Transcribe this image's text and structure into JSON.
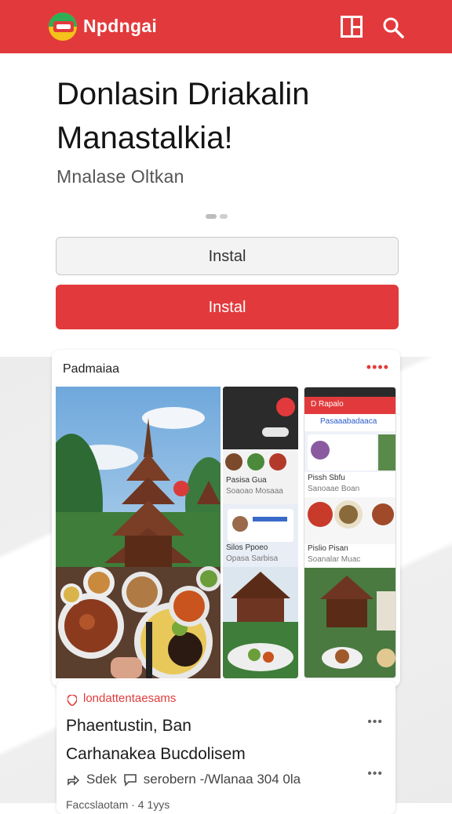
{
  "header": {
    "app_name": "Npdngai",
    "brand_color": "#e23a3c",
    "icons": [
      "app-logo-icon",
      "grid-layout-icon",
      "search-icon"
    ]
  },
  "hero": {
    "title_line1": "Donlasin Driakalin",
    "title_line2": "Manastalkia!",
    "subtitle": "Mnalase Oltkan",
    "carousel_pages": 2,
    "carousel_active": 1
  },
  "actions": {
    "secondary_label": "Instal",
    "primary_label": "Instal"
  },
  "preview_card": {
    "title": "Padmaiaa",
    "more": "••••",
    "screens": {
      "second": {
        "item1": "Pasisa Gua",
        "item1_sub": "Soaoao Mosaaa",
        "item2": "Silos Ppoeo",
        "item2_sub": "Opasa Sarbisa"
      },
      "third": {
        "header": "D Rapalo",
        "banner": "Pasaaabadaaca",
        "item1": "Pissh Sbfu",
        "item1_sub": "Sanoaae Boan",
        "item2": "Pislio Pisan",
        "item2_sub": "Soanalar Muac"
      }
    }
  },
  "feed": {
    "source": "londattentaesams",
    "title_line1": "Phaentustin, Ban",
    "title_line2": "Carhanakea Bucdolisem",
    "more": "•••",
    "meta_author": "Sdek",
    "meta_text": "serobern -/Wlanaa 304 0la",
    "bottom_text": "Faccslaotam · 4 1yys"
  }
}
